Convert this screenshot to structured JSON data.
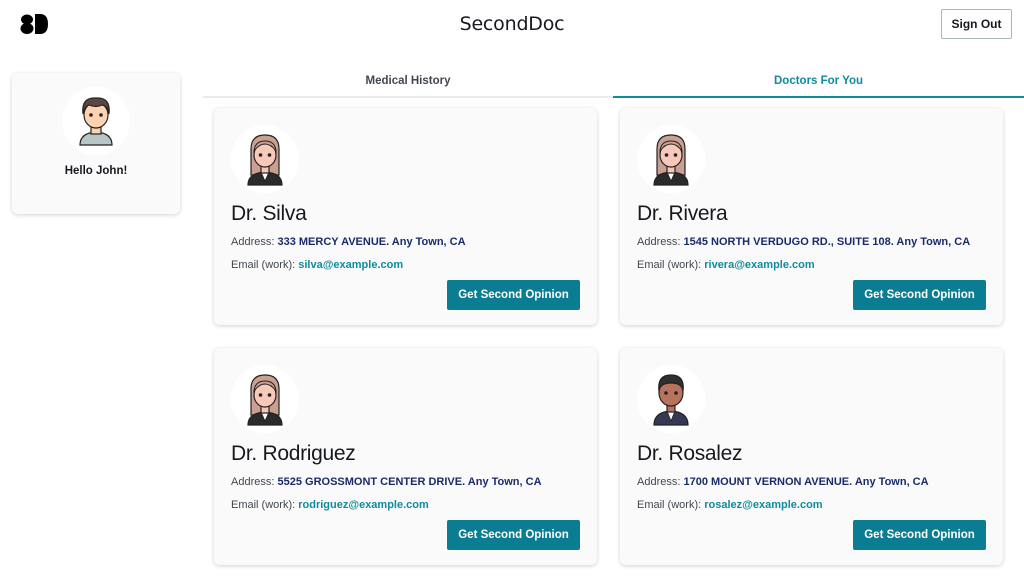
{
  "header": {
    "logo_text": "SD",
    "title": "SecondDoc",
    "sign_out_label": "Sign Out"
  },
  "profile": {
    "greeting": "Hello John!",
    "avatar": "male-user-avatar-icon"
  },
  "tabs": [
    {
      "label": "Medical History",
      "active": false
    },
    {
      "label": "Doctors For You",
      "active": true
    }
  ],
  "doctors": [
    {
      "name": "Dr. Silva",
      "address_label": "Address:",
      "address": "333 MERCY AVENUE. Any Town, CA",
      "email_label": "Email (work):",
      "email": "silva@example.com",
      "button_label": "Get Second Opinion",
      "avatar": "female-doctor-avatar-icon"
    },
    {
      "name": "Dr. Rivera",
      "address_label": "Address:",
      "address": "1545 NORTH VERDUGO RD., SUITE 108. Any Town, CA",
      "email_label": "Email (work):",
      "email": "rivera@example.com",
      "button_label": "Get Second Opinion",
      "avatar": "female-doctor-avatar-icon"
    },
    {
      "name": "Dr. Rodriguez",
      "address_label": "Address:",
      "address": "5525 GROSSMONT CENTER DRIVE. Any Town, CA",
      "email_label": "Email (work):",
      "email": "rodriguez@example.com",
      "button_label": "Get Second Opinion",
      "avatar": "female-doctor-avatar-icon"
    },
    {
      "name": "Dr. Rosalez",
      "address_label": "Address:",
      "address": "1700 MOUNT VERNON AVENUE. Any Town, CA",
      "email_label": "Email (work):",
      "email": "rosalez@example.com",
      "button_label": "Get Second Opinion",
      "avatar": "male-doctor-avatar-icon"
    }
  ],
  "colors": {
    "accent": "#0a7d93",
    "tab_active": "#0f8ba0",
    "address_value": "#1a2b6b",
    "card_bg": "#fafafa"
  }
}
